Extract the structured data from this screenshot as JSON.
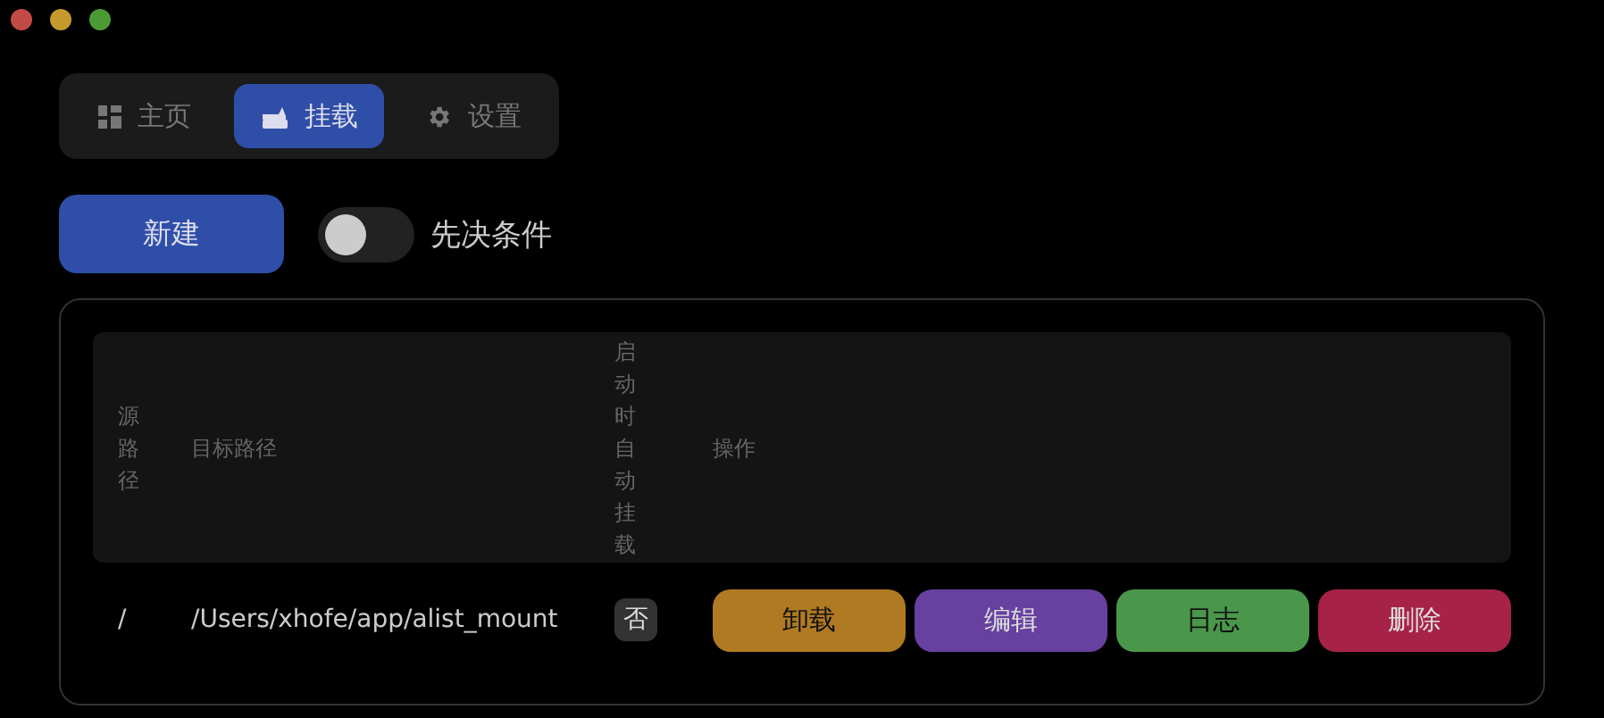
{
  "tabs": [
    {
      "label": "主页",
      "kind": "home",
      "selected": false
    },
    {
      "label": "挂载",
      "kind": "mounts",
      "selected": true
    },
    {
      "label": "设置",
      "kind": "settings",
      "selected": false
    }
  ],
  "new_button": "新建",
  "prerequisite_toggle": {
    "label": "先决条件",
    "on": false
  },
  "table": {
    "columns": [
      "源路径",
      "目标路径",
      "启动时自动挂载",
      "操作"
    ],
    "rows": [
      {
        "source": "/",
        "target": "/Users/xhofe/app/alist_mount",
        "auto_mount": "否",
        "actions": [
          {
            "label": "卸载",
            "color": "#b07a22"
          },
          {
            "label": "编辑",
            "color": "#6740a0"
          },
          {
            "label": "日志",
            "color": "#4a974b"
          },
          {
            "label": "删除",
            "color": "#a72248"
          }
        ]
      }
    ]
  }
}
